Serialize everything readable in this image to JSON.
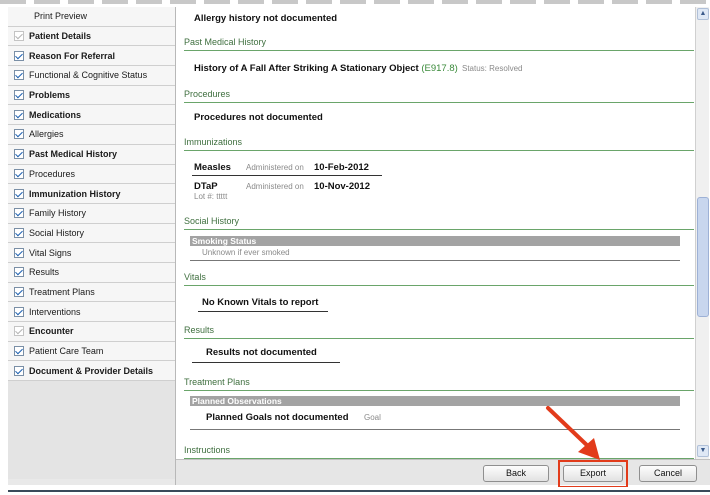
{
  "sidebar": {
    "items": [
      {
        "label": "Print Preview",
        "checked": false,
        "bold": false,
        "icon": "none"
      },
      {
        "label": "Patient Details",
        "checked": true,
        "bold": true,
        "icon": "faint-check"
      },
      {
        "label": "Reason For Referral",
        "checked": true,
        "bold": true,
        "icon": "checkbox"
      },
      {
        "label": "Functional & Cognitive Status",
        "checked": true,
        "bold": false,
        "icon": "checkbox"
      },
      {
        "label": "Problems",
        "checked": true,
        "bold": true,
        "icon": "checkbox"
      },
      {
        "label": "Medications",
        "checked": true,
        "bold": true,
        "icon": "checkbox"
      },
      {
        "label": "Allergies",
        "checked": true,
        "bold": false,
        "icon": "checkbox"
      },
      {
        "label": "Past Medical History",
        "checked": true,
        "bold": true,
        "icon": "checkbox"
      },
      {
        "label": "Procedures",
        "checked": true,
        "bold": false,
        "icon": "checkbox"
      },
      {
        "label": "Immunization History",
        "checked": true,
        "bold": true,
        "icon": "checkbox"
      },
      {
        "label": "Family History",
        "checked": true,
        "bold": false,
        "icon": "checkbox"
      },
      {
        "label": "Social History",
        "checked": true,
        "bold": false,
        "icon": "checkbox"
      },
      {
        "label": "Vital Signs",
        "checked": true,
        "bold": false,
        "icon": "checkbox"
      },
      {
        "label": "Results",
        "checked": true,
        "bold": false,
        "icon": "checkbox"
      },
      {
        "label": "Treatment Plans",
        "checked": true,
        "bold": false,
        "icon": "checkbox"
      },
      {
        "label": "Interventions",
        "checked": true,
        "bold": false,
        "icon": "checkbox"
      },
      {
        "label": "Encounter",
        "checked": true,
        "bold": true,
        "icon": "faint-check"
      },
      {
        "label": "Patient Care Team",
        "checked": true,
        "bold": false,
        "icon": "checkbox"
      },
      {
        "label": "Document & Provider Details",
        "checked": true,
        "bold": true,
        "icon": "checkbox"
      }
    ]
  },
  "content": {
    "allergy_text": "Allergy history not documented",
    "past_medical": {
      "title": "Past Medical History",
      "entry": "History of A Fall After Striking A Stationary Object",
      "code": "(E917.8)",
      "status_label": "Status:",
      "status_value": "Resolved"
    },
    "procedures": {
      "title": "Procedures",
      "text": "Procedures not documented"
    },
    "immunizations": {
      "title": "Immunizations",
      "entries": [
        {
          "name": "Measles",
          "admin_label": "Administered on",
          "date": "10-Feb-2012",
          "lot": ""
        },
        {
          "name": "DTaP",
          "admin_label": "Administered on",
          "date": "10-Nov-2012",
          "lot": "Lot #:  ttttt"
        }
      ]
    },
    "social_history": {
      "title": "Social History",
      "bar": "Smoking Status",
      "text": "Unknown if ever smoked"
    },
    "vitals": {
      "title": "Vitals",
      "text": "No Known Vitals to report"
    },
    "results": {
      "title": "Results",
      "text": "Results not documented"
    },
    "treatment_plans": {
      "title": "Treatment Plans",
      "bar": "Planned Observations",
      "text": "Planned Goals not documented",
      "tag": "Goal"
    },
    "instructions": {
      "title": "Instructions"
    }
  },
  "footer": {
    "back_label": "Back",
    "export_label": "Export",
    "cancel_label": "Cancel"
  },
  "colors": {
    "section_rule": "#6aa56a",
    "highlight": "#e23b1b",
    "arrow": "#e23b1b"
  },
  "icons": [
    "checkbox-icon",
    "scroll-up-icon",
    "scroll-down-icon",
    "annotation-arrow-icon"
  ]
}
